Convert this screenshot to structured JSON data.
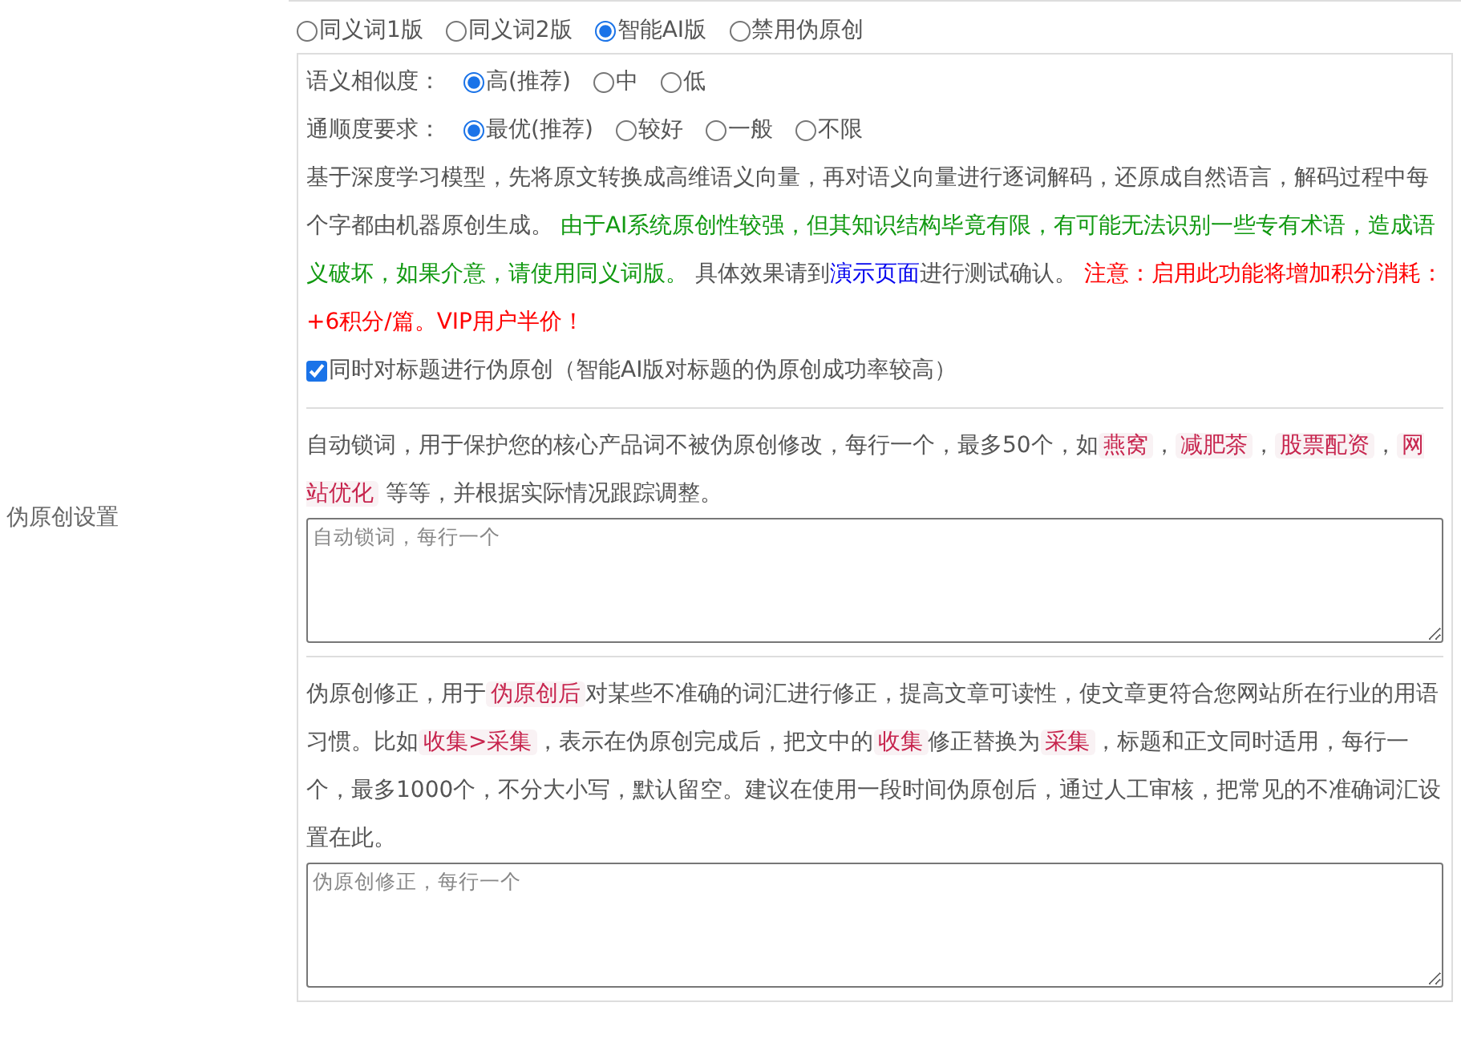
{
  "section_label": "伪原创设置",
  "modes": [
    {
      "label": "同义词1版",
      "selected": false
    },
    {
      "label": "同义词2版",
      "selected": false
    },
    {
      "label": "智能AI版",
      "selected": true
    },
    {
      "label": "禁用伪原创",
      "selected": false
    }
  ],
  "similarity": {
    "label": "语义相似度：",
    "options": [
      {
        "label": "高(推荐)",
        "selected": true
      },
      {
        "label": "中",
        "selected": false
      },
      {
        "label": "低",
        "selected": false
      }
    ]
  },
  "fluency": {
    "label": "通顺度要求：",
    "options": [
      {
        "label": "最优(推荐)",
        "selected": true
      },
      {
        "label": "较好",
        "selected": false
      },
      {
        "label": "一般",
        "selected": false
      },
      {
        "label": "不限",
        "selected": false
      }
    ]
  },
  "ai_description": [
    {
      "kind": "text",
      "text": "基于深度学习模型，先将原文转换成高维语义向量，再对语义向量进行逐词解码，还原成自然语言，解码过程中每个字都由机器原创生成。 "
    },
    {
      "kind": "warning",
      "text": "由于AI系统原创性较强，但其知识结构毕竟有限，有可能无法识别一些专有术语，造成语义破坏，如果介意，请使用同义词版。"
    },
    {
      "kind": "text",
      "text": " 具体效果请到"
    },
    {
      "kind": "link",
      "text": "演示页面"
    },
    {
      "kind": "text",
      "text": "进行测试确认。 "
    },
    {
      "kind": "alert",
      "text": "注意：启用此功能将增加积分消耗：+6积分/篇。VIP用户半价！"
    }
  ],
  "title_option": {
    "label": "同时对标题进行伪原创（智能AI版对标题的伪原创成功率较高）",
    "checked": true
  },
  "lock_words": {
    "description": [
      {
        "kind": "text",
        "text": "自动锁词，用于保护您的核心产品词不被伪原创修改，每行一个，最多50个，如"
      },
      {
        "kind": "tag",
        "text": "燕窝"
      },
      {
        "kind": "text",
        "text": "，"
      },
      {
        "kind": "tag",
        "text": "减肥茶"
      },
      {
        "kind": "text",
        "text": "，"
      },
      {
        "kind": "tag",
        "text": "股票配资"
      },
      {
        "kind": "text",
        "text": "，"
      },
      {
        "kind": "tag",
        "text": "网站优化"
      },
      {
        "kind": "text",
        "text": " 等等，并根据实际情况跟踪调整。"
      }
    ],
    "placeholder": "自动锁词，每行一个"
  },
  "corrections": {
    "description": [
      {
        "kind": "text",
        "text": "伪原创修正，用于"
      },
      {
        "kind": "tag",
        "text": "伪原创后"
      },
      {
        "kind": "text",
        "text": "对某些不准确的词汇进行修正，提高文章可读性，使文章更符合您网站所在行业的用语习惯。比如"
      },
      {
        "kind": "tag",
        "text": "收集>采集"
      },
      {
        "kind": "text",
        "text": "，表示在伪原创完成后，把文中的"
      },
      {
        "kind": "tag",
        "text": "收集"
      },
      {
        "kind": "text",
        "text": "修正替换为"
      },
      {
        "kind": "tag",
        "text": "采集"
      },
      {
        "kind": "text",
        "text": "，标题和正文同时适用，每行一个，最多1000个，不分大小写，默认留空。建议在使用一段时间伪原创后，通过人工审核，把常见的不准确词汇设置在此。"
      }
    ],
    "placeholder": "伪原创修正，每行一个"
  }
}
